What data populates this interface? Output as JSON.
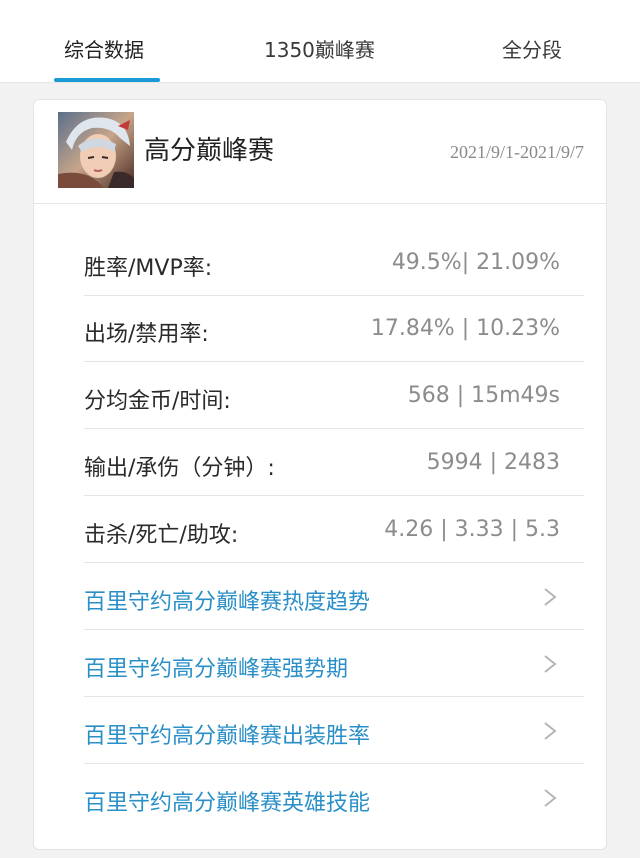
{
  "tabs": [
    {
      "label": "综合数据",
      "active": true
    },
    {
      "label": "1350巅峰赛",
      "active": false
    },
    {
      "label": "全分段",
      "active": false
    }
  ],
  "accent_color": "#1a9ad6",
  "link_color": "#2a8fc7",
  "card": {
    "title": "高分巅峰赛",
    "date_range": "2021/9/1-2021/9/7",
    "stats": [
      {
        "label": "胜率/MVP率:",
        "value": "49.5%| 21.09%"
      },
      {
        "label": "出场/禁用率:",
        "value": "17.84% | 10.23%"
      },
      {
        "label": "分均金币/时间:",
        "value": "568 | 15m49s"
      },
      {
        "label": "输出/承伤（分钟）:",
        "value": "5994 | 2483"
      },
      {
        "label": "击杀/死亡/助攻:",
        "value": "4.26 | 3.33 | 5.3"
      }
    ],
    "links": [
      {
        "label": "百里守约高分巅峰赛热度趋势",
        "icon": "chevron-right-icon"
      },
      {
        "label": "百里守约高分巅峰赛强势期",
        "icon": "chevron-right-icon"
      },
      {
        "label": "百里守约高分巅峰赛出装胜率",
        "icon": "chevron-right-icon"
      },
      {
        "label": "百里守约高分巅峰赛英雄技能",
        "icon": "chevron-right-icon"
      }
    ]
  }
}
